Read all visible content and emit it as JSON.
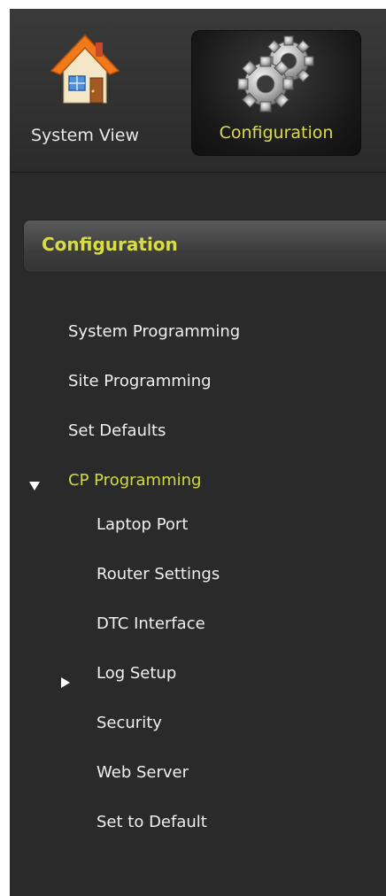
{
  "topnav": {
    "items": [
      {
        "label": "System View",
        "icon": "house-icon",
        "selected": false
      },
      {
        "label": "Configuration",
        "icon": "gears-icon",
        "selected": true
      }
    ]
  },
  "section": {
    "title": "Configuration"
  },
  "menu": {
    "items": [
      {
        "label": "System Programming",
        "level": 0
      },
      {
        "label": "Site Programming",
        "level": 0
      },
      {
        "label": "Set Defaults",
        "level": 0
      },
      {
        "label": "CP Programming",
        "level": 0,
        "expanded": true,
        "active": true
      },
      {
        "label": "Laptop Port",
        "level": 1
      },
      {
        "label": "Router Settings",
        "level": 1
      },
      {
        "label": "DTC Interface",
        "level": 1
      },
      {
        "label": "Log Setup",
        "level": 1,
        "collapsed": true
      },
      {
        "label": "Security",
        "level": 1
      },
      {
        "label": "Web Server",
        "level": 1
      },
      {
        "label": "Set to Default",
        "level": 1
      }
    ]
  },
  "colors": {
    "accent": "#d7dd45",
    "background": "#2a2a2a",
    "text": "#f0f0f0"
  }
}
